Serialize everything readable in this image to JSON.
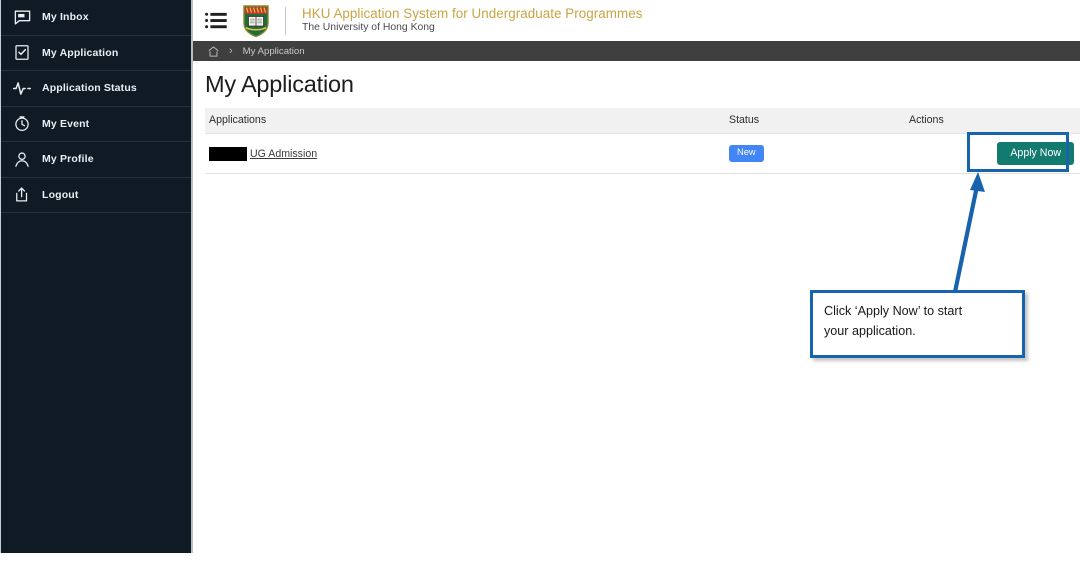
{
  "sidebar": {
    "items": [
      {
        "label": "My Inbox",
        "icon": "inbox-chat-icon"
      },
      {
        "label": "My Application",
        "icon": "checkbox-document-icon"
      },
      {
        "label": "Application Status",
        "icon": "pulse-activity-icon"
      },
      {
        "label": "My Event",
        "icon": "clock-icon"
      },
      {
        "label": "My Profile",
        "icon": "person-icon"
      },
      {
        "label": "Logout",
        "icon": "logout-share-icon"
      }
    ]
  },
  "header": {
    "menu_icon": "list-menu-icon",
    "logo_icon": "hku-crest-icon",
    "title": "HKU Application System for Undergraduate Programmes",
    "subtitle": "The University of Hong Kong",
    "title_color": "#c8a444"
  },
  "breadcrumb": {
    "home_icon": "home-icon",
    "separator": "›",
    "current": "My Application"
  },
  "page": {
    "title": "My Application"
  },
  "table": {
    "columns": [
      "Applications",
      "Status",
      "Actions"
    ],
    "rows": [
      {
        "application": "UG Admission",
        "redacted": true,
        "status": "New",
        "status_color": "#4285f4",
        "action_label": "Apply Now",
        "action_color": "#137a6e"
      }
    ]
  },
  "annotation": {
    "callout_text": "Click ‘Apply Now’ to start\nyour application.",
    "accent_color": "#1763ae",
    "arrow_icon": "arrow-up-pointer"
  }
}
